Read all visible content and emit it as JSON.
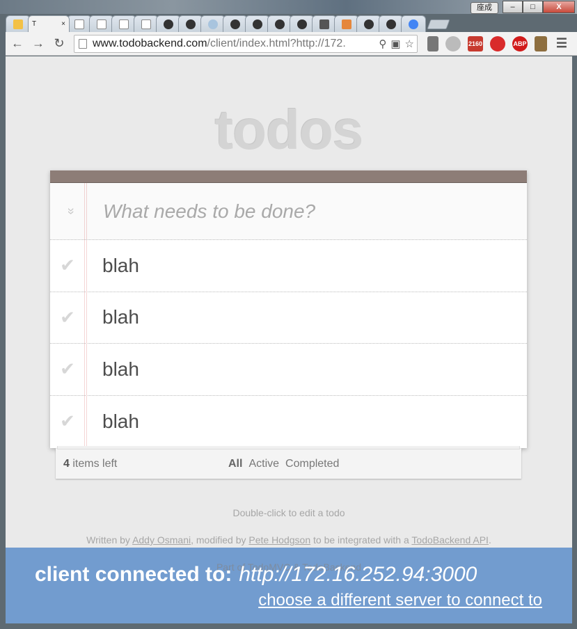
{
  "window": {
    "user_button": "座成",
    "controls": [
      "–",
      "□",
      "X"
    ]
  },
  "tabs": {
    "active_title": "T",
    "active_close": "×"
  },
  "toolbar": {
    "url_host": "www.todobackend.com",
    "url_rest": "/client/index.html?http://172.",
    "ext_gmail_count": "2160",
    "ext_abp": "ABP"
  },
  "app": {
    "title": "todos",
    "new_todo_placeholder": "What needs to be done?",
    "toggle_all_icon": "»",
    "todos": [
      {
        "label": "blah",
        "check": "✔"
      },
      {
        "label": "blah",
        "check": "✔"
      },
      {
        "label": "blah",
        "check": "✔"
      },
      {
        "label": "blah",
        "check": "✔"
      }
    ],
    "footer": {
      "count": "4",
      "count_suffix": " items left",
      "filters": [
        "All",
        "Active",
        "Completed"
      ]
    }
  },
  "info": {
    "hint": "Double-click to edit a todo",
    "written_by_prefix": "Written by ",
    "author1": "Addy Osmani",
    "modified_by": ", modified by ",
    "author2": "Pete Hodgson",
    "integrated": " to be integrated with a ",
    "api_link": "TodoBackend API",
    "period": ".",
    "part_of": "Part of TodoMVC & TodoBackend"
  },
  "overlay": {
    "label": "client connected to:",
    "url": "http://172.16.252.94:3000",
    "change_link": "choose a different server to connect to"
  },
  "colors": {
    "header_bar": "#8d7d77",
    "overlay": "#6b98cd",
    "brand_text": "#d4d4d4"
  }
}
